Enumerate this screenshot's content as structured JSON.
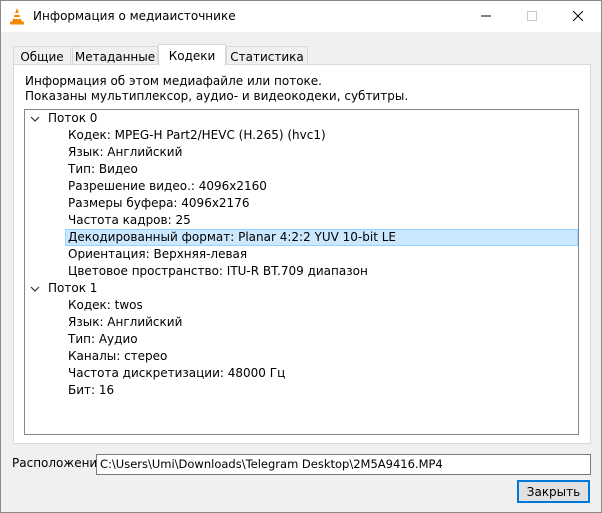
{
  "window": {
    "title": "Информация о медиаисточнике",
    "icon": "vlc-cone-icon"
  },
  "tabs": [
    {
      "label": "Общие",
      "active": false
    },
    {
      "label": "Метаданные",
      "active": false
    },
    {
      "label": "Кодеки",
      "active": true
    },
    {
      "label": "Статистика",
      "active": false
    }
  ],
  "description": {
    "line1": "Информация об этом медиафайле или потоке.",
    "line2": "Показаны мультиплексор, аудио- и видеокодеки, субтитры."
  },
  "tree": {
    "streams": [
      {
        "label": "Поток 0",
        "expanded": true,
        "items": [
          "Кодек: MPEG-H Part2/HEVC (H.265) (hvc1)",
          "Язык: Английский",
          "Тип: Видео",
          "Разрешение видео.: 4096x2160",
          "Размеры буфера: 4096x2176",
          "Частота кадров: 25",
          "Декодированный формат: Planar 4:2:2 YUV 10-bit LE",
          "Ориентация: Верхняя-левая",
          "Цветовое пространство: ITU-R BT.709 диапазон"
        ],
        "selected_index": 6
      },
      {
        "label": "Поток 1",
        "expanded": true,
        "items": [
          "Кодек: twos",
          "Язык: Английский",
          "Тип: Аудио",
          "Каналы: стерео",
          "Частота дискретизации: 48000 Гц",
          "Бит: 16"
        ]
      }
    ]
  },
  "location": {
    "label": "Расположение:",
    "value": "C:\\Users\\Umi\\Downloads\\Telegram Desktop\\2M5A9416.MP4"
  },
  "buttons": {
    "close": "Закрыть"
  },
  "colors": {
    "selection_bg": "#cce8ff",
    "selection_border": "#99d1ff",
    "focus_accent": "#0078d7"
  }
}
